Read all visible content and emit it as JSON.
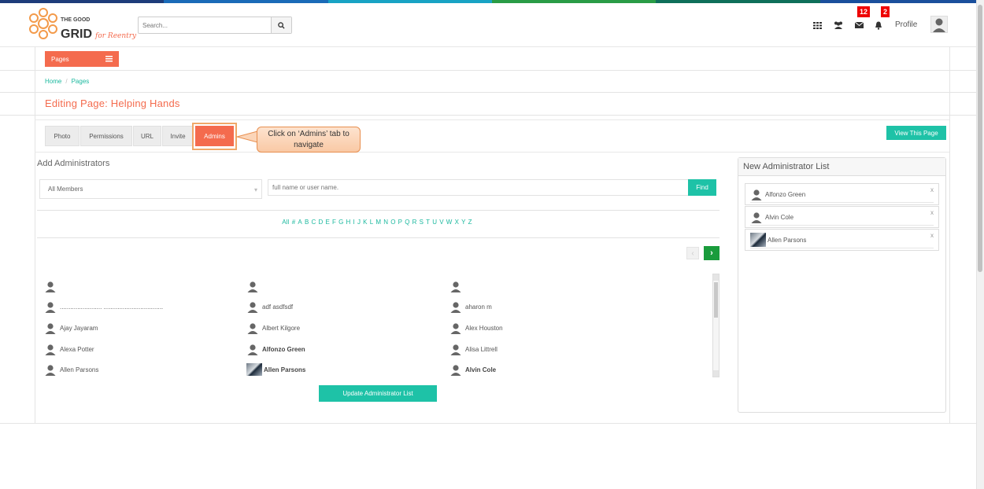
{
  "brand": {
    "logo_text_top": "THE GOOD",
    "logo_text_grid": "GRID",
    "logo_text_script": "for Reentry",
    "accent": "#f46b4e",
    "teal": "#1ec2a7"
  },
  "header": {
    "search_placeholder": "Search...",
    "messages_count": "12",
    "notifications_count": "2",
    "profile_label": "Profile"
  },
  "pages_button": "Pages",
  "breadcrumb": {
    "home": "Home",
    "sep": "/",
    "current": "Pages"
  },
  "page_title": "Editing Page: Helping Hands",
  "tabs": [
    "Photo",
    "Permissions",
    "URL",
    "Invite",
    "Admins"
  ],
  "active_tab": "Admins",
  "callout_text": "Click on ‘Admins’ tab to navigate",
  "view_page_button": "View This Page",
  "add_admins": {
    "title": "Add Administrators",
    "filter_value": "All Members",
    "name_placeholder": "full name or user name.",
    "find_button": "Find",
    "alphabet": [
      "All",
      "#",
      "A",
      "B",
      "C",
      "D",
      "E",
      "F",
      "G",
      "H",
      "I",
      "J",
      "K",
      "L",
      "M",
      "N",
      "O",
      "P",
      "Q",
      "R",
      "S",
      "T",
      "U",
      "V",
      "W",
      "X",
      "Y",
      "Z"
    ],
    "members": [
      [
        {
          "name": "",
          "bold": false,
          "photo": false
        },
        {
          "name": "",
          "bold": false,
          "photo": false
        },
        {
          "name": "",
          "bold": false,
          "photo": false
        }
      ],
      [
        {
          "name": "........................ ..................................",
          "bold": false,
          "photo": false
        },
        {
          "name": "adf asdfsdf",
          "bold": false,
          "photo": false
        },
        {
          "name": "aharon m",
          "bold": false,
          "photo": false
        }
      ],
      [
        {
          "name": "Ajay Jayaram",
          "bold": false,
          "photo": false
        },
        {
          "name": "Albert Kilgore",
          "bold": false,
          "photo": false
        },
        {
          "name": "Alex Houston",
          "bold": false,
          "photo": false
        }
      ],
      [
        {
          "name": "Alexa Potter",
          "bold": false,
          "photo": false
        },
        {
          "name": "Alfonzo Green",
          "bold": true,
          "photo": false
        },
        {
          "name": "Alisa Littrell",
          "bold": false,
          "photo": false
        }
      ],
      [
        {
          "name": "Allen Parsons",
          "bold": false,
          "photo": false
        },
        {
          "name": "Allen Parsons",
          "bold": true,
          "photo": true
        },
        {
          "name": "Alvin Cole",
          "bold": true,
          "photo": false
        }
      ]
    ],
    "update_button": "Update Administrator List"
  },
  "new_admin_list": {
    "title": "New Administrator List",
    "items": [
      {
        "name": "Alfonzo Green",
        "photo": false
      },
      {
        "name": "Alvin Cole",
        "photo": false
      },
      {
        "name": "Allen Parsons",
        "photo": true
      }
    ],
    "remove_label": "x"
  }
}
